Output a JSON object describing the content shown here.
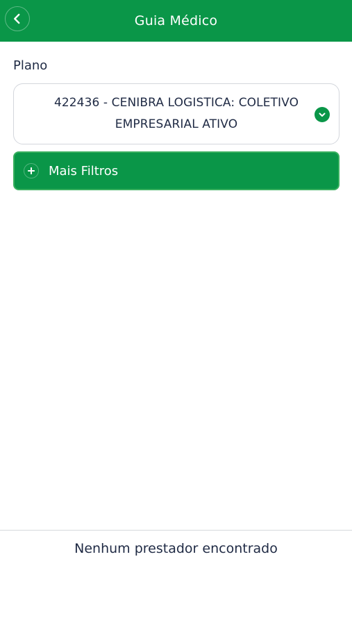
{
  "header": {
    "title": "Guia Médico",
    "back_icon": "chevron-left-icon"
  },
  "form": {
    "plan_label": "Plano",
    "plan_value": "422436 - CENIBRA LOGISTICA: COLETIVO EMPRESARIAL ATIVO",
    "plan_icon": "chevron-down-icon",
    "filters_label": "Mais Filtros",
    "filters_icon": "plus-icon"
  },
  "results": {
    "empty_message": "Nenhum prestador encontrado"
  },
  "colors": {
    "brand_green": "#0a9648",
    "text": "#1f2a44",
    "border": "#d3d6dc"
  }
}
